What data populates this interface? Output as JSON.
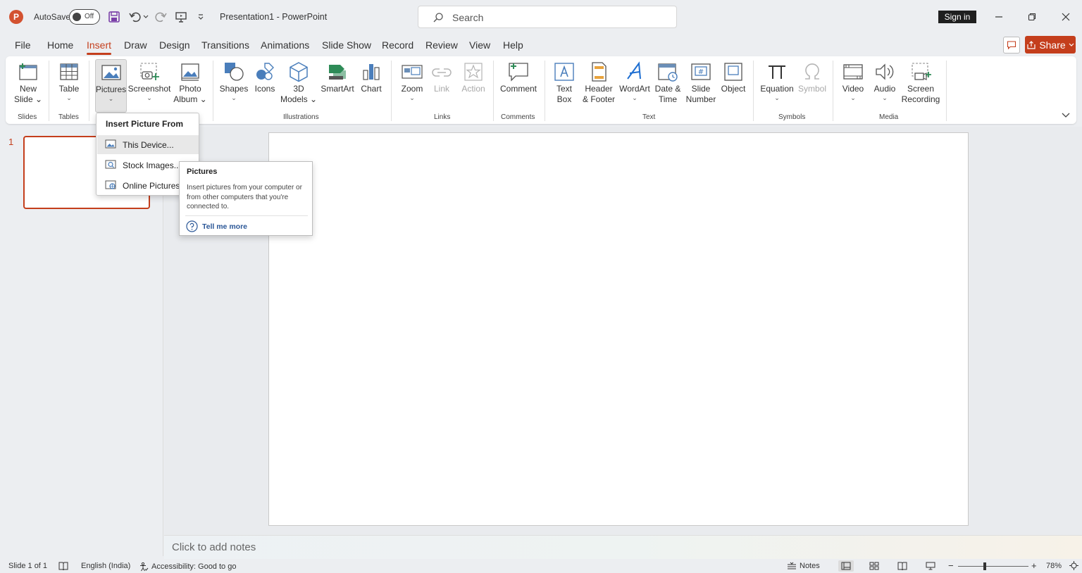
{
  "titlebar": {
    "app_logo": "P",
    "autosave_label": "AutoSave",
    "autosave_state": "Off",
    "doc_title": "Presentation1  -  PowerPoint",
    "search_placeholder": "Search",
    "signin_label": "Sign in",
    "icons": [
      "save-icon",
      "undo-icon",
      "redo-icon",
      "present-icon",
      "customize-qat-icon",
      "minimize-icon",
      "restore-icon",
      "close-icon"
    ]
  },
  "tabs": [
    "File",
    "Home",
    "Insert",
    "Draw",
    "Design",
    "Transitions",
    "Animations",
    "Slide Show",
    "Record",
    "Review",
    "View",
    "Help"
  ],
  "active_tab": "Insert",
  "share_label": "Share",
  "ribbon": {
    "buttons": {
      "new_slide": [
        "New",
        "Slide"
      ],
      "table": "Table",
      "pictures": "Pictures",
      "screenshot": "Screenshot",
      "photo_album": [
        "Photo",
        "Album"
      ],
      "shapes": "Shapes",
      "icons": "Icons",
      "models3d": [
        "3D",
        "Models"
      ],
      "smartart": "SmartArt",
      "chart": "Chart",
      "zoom": "Zoom",
      "link": "Link",
      "action": "Action",
      "comment": "Comment",
      "text_box": [
        "Text",
        "Box"
      ],
      "header_footer": [
        "Header",
        "& Footer"
      ],
      "wordart": "WordArt",
      "date_time": [
        "Date &",
        "Time"
      ],
      "slide_number": [
        "Slide",
        "Number"
      ],
      "object": "Object",
      "equation": "Equation",
      "symbol": "Symbol",
      "video": "Video",
      "audio": "Audio",
      "screen_recording": [
        "Screen",
        "Recording"
      ]
    },
    "groups": {
      "slides": "Slides",
      "tables": "Tables",
      "illustrations": "Illustrations",
      "links": "Links",
      "comments": "Comments",
      "text": "Text",
      "symbols": "Symbols",
      "media": "Media"
    },
    "accent_color": "#c43e1c"
  },
  "slide_panel": {
    "slide_number": "1"
  },
  "dropdown": {
    "header": "Insert Picture From",
    "items": [
      "This Device...",
      "Stock Images...",
      "Online Pictures..."
    ]
  },
  "tooltip": {
    "title": "Pictures",
    "body": "Insert pictures from your computer or from other computers that you're connected to.",
    "link": "Tell me more"
  },
  "notes_placeholder": "Click to add notes",
  "statusbar": {
    "slide_info": "Slide 1 of 1",
    "language": "English (India)",
    "accessibility": "Accessibility: Good to go",
    "notes_label": "Notes",
    "zoom_level": "78%"
  }
}
